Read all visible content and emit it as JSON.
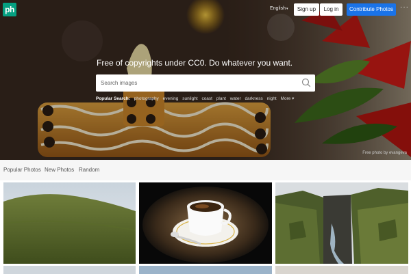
{
  "header": {
    "logo_text": "ph",
    "language": "English",
    "signup_label": "Sign up",
    "login_label": "Log in",
    "contribute_label": "Contribute Photos",
    "more_label": "···",
    "brand_color": "#05a081",
    "accent_color": "#1a73e8"
  },
  "hero": {
    "tagline": "Free of copyrights under CC0. Do whatever you want.",
    "search_placeholder": "Search images",
    "popular_label": "Popular Search:",
    "popular_terms": [
      "photography",
      "evening",
      "sunlight",
      "coast",
      "plant",
      "water",
      "darkness",
      "night"
    ],
    "popular_more": "More",
    "credit": "Free photo by evangeva"
  },
  "subnav": {
    "items": [
      "Popular Photos",
      "New Photos",
      "Random"
    ]
  },
  "photos": [
    {
      "subject": "grassy hill under cloudy sky"
    },
    {
      "subject": "coffee cup on saucer with spoon"
    },
    {
      "subject": "mossy canyon with river"
    },
    {
      "subject": "building roof"
    },
    {
      "subject": "sky"
    },
    {
      "subject": "light landscape"
    }
  ]
}
